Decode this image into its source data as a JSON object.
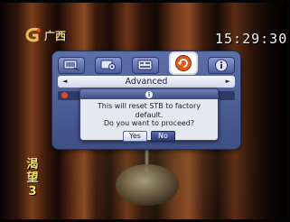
{
  "channel": {
    "logo_text": "广西",
    "caption_chars": [
      "渴",
      "望",
      "3"
    ]
  },
  "clock": {
    "time": "15:29:30"
  },
  "menu": {
    "icons": [
      {
        "name": "tv-settings-icon",
        "active": false
      },
      {
        "name": "system-settings-icon",
        "active": false
      },
      {
        "name": "program-guide-icon",
        "active": false
      },
      {
        "name": "factory-reset-icon",
        "active": true
      },
      {
        "name": "info-icon",
        "active": false
      }
    ],
    "submenu_label": "Advanced",
    "left_arrow": "◄",
    "right_arrow": "►"
  },
  "dialog": {
    "header_icon": "i",
    "line1": "This will reset STB to factory default.",
    "line2": "Do you want to proceed?",
    "yes_label": "Yes",
    "no_label": "No",
    "focused_button": "No"
  },
  "colors": {
    "panel": "#4b5c98",
    "dialog_bg": "#e6e8f0",
    "clock": "#f4f4f4",
    "caption": "#f0e060",
    "logo": "#f0d070"
  }
}
